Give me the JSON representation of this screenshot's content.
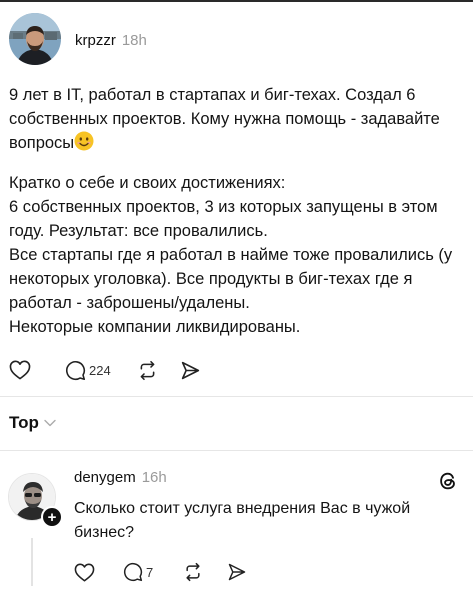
{
  "post": {
    "username": "krpzzr",
    "timestamp": "18h",
    "paragraph1": "9 лет в IT, работал в стартапах и биг-техах. Создал 6 собственных проектов. Кому нужна помощь - задавайте вопросы",
    "emoji": "smiling-face-emoji",
    "paragraph2": "Кратко о себе и своих достижениях:",
    "paragraph3": "6 собственных проектов, 3 из которых запущены в этом году. Результат: все провалились.",
    "paragraph4": "Все стартапы где я работал в найме тоже провалились (у некоторых уголовка). Все продукты в биг-техах где я работал - заброшены/удалены.",
    "paragraph5": "Некоторые компании ликвидированы.",
    "actions": {
      "like_icon": "heart-icon",
      "reply_icon": "comment-bubble-icon",
      "reply_count": "224",
      "repost_icon": "repost-icon",
      "share_icon": "send-icon"
    }
  },
  "sort": {
    "label": "Top",
    "icon": "chevron-down-icon"
  },
  "reply": {
    "username": "denygem",
    "timestamp": "16h",
    "text": "Сколько стоит услуга внедрения Вас в чужой бизнес?",
    "follow_badge": "+",
    "brand_icon": "threads-logo-icon",
    "actions": {
      "like_icon": "heart-icon",
      "reply_icon": "comment-bubble-icon",
      "reply_count": "7",
      "repost_icon": "repost-icon",
      "share_icon": "send-icon"
    }
  },
  "colors": {
    "text": "#141414",
    "muted": "#9a9a9a",
    "divider": "#e6e6e6",
    "emoji_yellow": "#f7c325"
  }
}
